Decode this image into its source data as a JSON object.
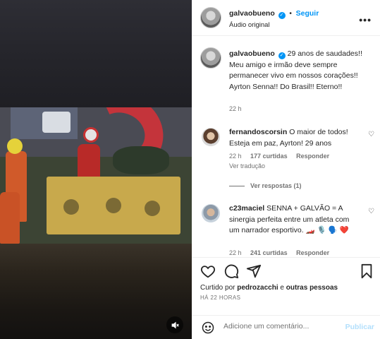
{
  "post_author": {
    "username": "galvaobueno",
    "follow_label": "Seguir",
    "audio_label": "Áudio original"
  },
  "caption": {
    "username": "galvaobueno",
    "text": "29 anos de saudades!! Meu amigo e irmão deve sempre permanecer vivo em nossos corações!! Ayrton Senna!! Do Brasil!! Eterno!!",
    "time": "22 h"
  },
  "comments": [
    {
      "username": "fernandoscorsin",
      "text": "O maior de todos! Esteja em paz, Ayrton! 29 anos",
      "time": "22 h",
      "likes": "177 curtidas",
      "reply_label": "Responder",
      "translate_label": "Ver tradução",
      "view_replies": "Ver respostas (1)"
    },
    {
      "username": "c23maciel",
      "text": "SENNA + GALVÃO = A sinergia perfeita entre um atleta com um narrador esportivo. 🏎️ 🎙️ 🗣️ ❤️",
      "time": "22 h",
      "likes": "241 curtidas",
      "reply_label": "Responder"
    }
  ],
  "actions": {
    "liked_prefix": "Curtido por",
    "liked_user": "pedrozacchi",
    "liked_suffix": "e",
    "liked_others": "outras pessoas",
    "timestamp": "HÁ 22 HORAS"
  },
  "comment_box": {
    "placeholder": "Adicione um comentário...",
    "publish_label": "Publicar"
  },
  "icons": {
    "verified": "verified-badge-icon",
    "more": "more-options-icon",
    "like": "heart-icon",
    "comment": "comment-bubble-icon",
    "share": "paper-plane-icon",
    "save": "bookmark-icon",
    "emoji": "emoji-smile-icon",
    "mute": "speaker-muted-icon"
  },
  "colors": {
    "accent": "#0095f6",
    "publish_disabled": "#b2dffc",
    "secondary_text": "#737373",
    "heart_red": "#ed4956"
  }
}
